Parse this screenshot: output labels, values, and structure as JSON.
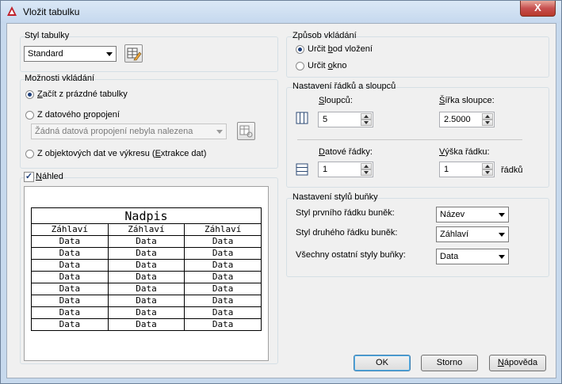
{
  "window": {
    "title": "Vložit tabulku",
    "close_label": "X"
  },
  "table_style": {
    "group_label": "Styl tabulky",
    "selected": "Standard"
  },
  "insert_options": {
    "group_label": "Možnosti vkládání",
    "option_empty": "Začít z prázdné tabulky",
    "option_link": "Z datového propojení",
    "link_combo": "Žádná datová propojení nebyla nalezena",
    "option_extract": "Z objektových dat ve výkresu (Extrakce dat)"
  },
  "preview": {
    "checkbox_label": "Náhled",
    "checked": true,
    "title": "Nadpis",
    "headers": [
      "Záhlaví",
      "Záhlaví",
      "Záhlaví"
    ],
    "rows": [
      [
        "Data",
        "Data",
        "Data"
      ],
      [
        "Data",
        "Data",
        "Data"
      ],
      [
        "Data",
        "Data",
        "Data"
      ],
      [
        "Data",
        "Data",
        "Data"
      ],
      [
        "Data",
        "Data",
        "Data"
      ],
      [
        "Data",
        "Data",
        "Data"
      ],
      [
        "Data",
        "Data",
        "Data"
      ],
      [
        "Data",
        "Data",
        "Data"
      ]
    ]
  },
  "insertion_method": {
    "group_label": "Způsob vkládání",
    "option_point": "Určit bod vložení",
    "option_window": "Určit okno"
  },
  "rows_cols": {
    "group_label": "Nastavení řádků a sloupců",
    "columns_label": "Sloupců:",
    "columns_value": "5",
    "col_width_label": "Šířka sloupce:",
    "col_width_value": "2.5000",
    "data_rows_label": "Datové řádky:",
    "data_rows_value": "1",
    "row_height_label": "Výška řádku:",
    "row_height_value": "1",
    "row_height_unit": "řádků"
  },
  "cell_styles": {
    "group_label": "Nastavení stylů buňky",
    "first_row_label": "Styl prvního řádku buněk:",
    "first_row_value": "Název",
    "second_row_label": "Styl druhého řádku buněk:",
    "second_row_value": "Záhlaví",
    "other_label": "Všechny ostatní styly buňky:",
    "other_value": "Data"
  },
  "buttons": {
    "ok": "OK",
    "cancel": "Storno",
    "help": "Nápověda"
  },
  "colors": {
    "accent": "#1e3f7a",
    "title_bar": "#c5d8ee",
    "close": "#c75050"
  }
}
